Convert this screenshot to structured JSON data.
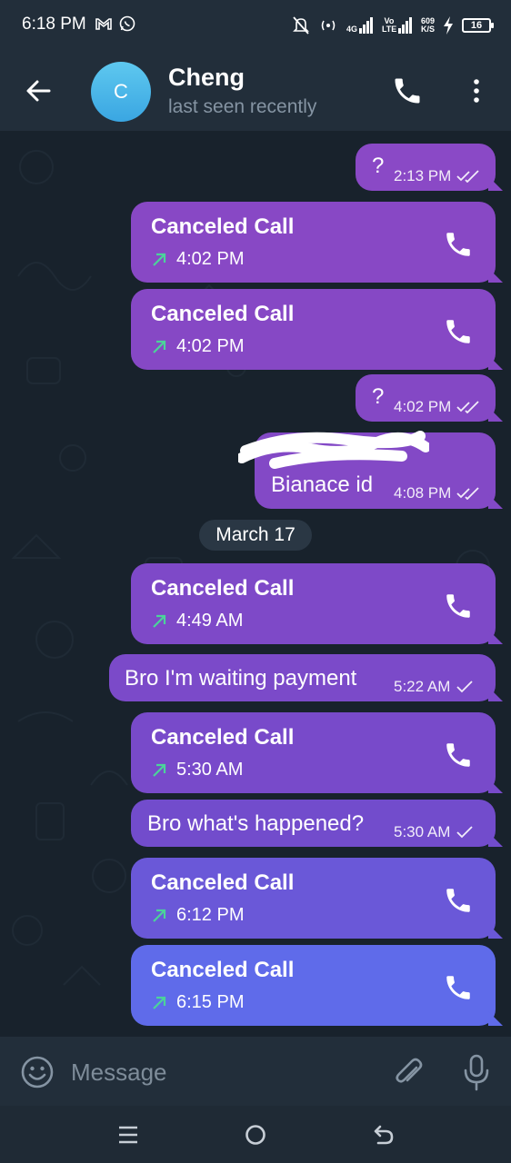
{
  "status_bar": {
    "time": "6:18 PM",
    "network_1": "4G",
    "network_2": "Vo LTE",
    "speed_value": "609",
    "speed_unit": "K/S",
    "battery": "16"
  },
  "header": {
    "avatar_letter": "C",
    "name": "Cheng",
    "status": "last seen recently"
  },
  "colors": {
    "header_bg": "#222e3a",
    "chat_bg": "#18222c",
    "bubble_top": "#8a4bc6",
    "bubble_bottom": "#5f6bea",
    "arrow_green": "#4bd39a"
  },
  "messages": [
    {
      "kind": "text",
      "text": "?",
      "time": "2:13 PM",
      "status": "read"
    },
    {
      "kind": "call",
      "title": "Canceled Call",
      "time": "4:02 PM"
    },
    {
      "kind": "call",
      "title": "Canceled Call",
      "time": "4:02 PM"
    },
    {
      "kind": "text",
      "text": "?",
      "time": "4:02 PM",
      "status": "read"
    },
    {
      "kind": "text",
      "text": "Bianace id",
      "time": "4:08 PM",
      "status": "read"
    },
    {
      "kind": "date",
      "text": "March 17"
    },
    {
      "kind": "call",
      "title": "Canceled Call",
      "time": "4:49 AM"
    },
    {
      "kind": "text",
      "text": "Bro I'm waiting payment",
      "time": "5:22 AM",
      "status": "sent"
    },
    {
      "kind": "call",
      "title": "Canceled Call",
      "time": "5:30 AM"
    },
    {
      "kind": "text",
      "text": "Bro what's happened?",
      "time": "5:30 AM",
      "status": "sent"
    },
    {
      "kind": "call",
      "title": "Canceled Call",
      "time": "6:12 PM"
    },
    {
      "kind": "call",
      "title": "Canceled Call",
      "time": "6:15 PM"
    }
  ],
  "composer": {
    "placeholder": "Message"
  },
  "icons": {
    "back": "arrow-left-icon",
    "call": "phone-icon",
    "more": "more-vertical-icon",
    "emoji": "smiley-icon",
    "attach": "paperclip-icon",
    "mic": "microphone-icon"
  }
}
